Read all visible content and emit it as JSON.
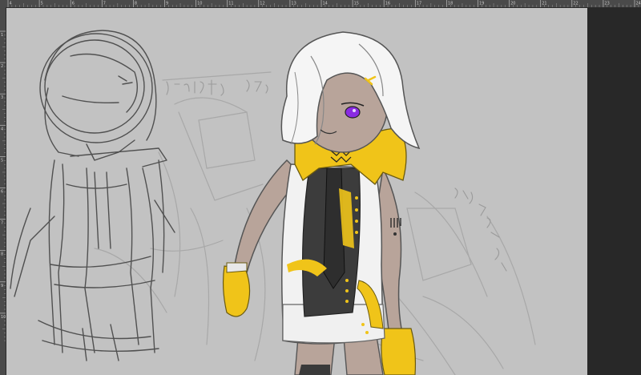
{
  "ruler": {
    "top_labels": [
      "4",
      "5",
      "6",
      "7",
      "8",
      "9",
      "10",
      "11",
      "12",
      "13",
      "14",
      "15",
      "16",
      "17",
      "18",
      "19",
      "20",
      "21",
      "22",
      "23",
      "24"
    ],
    "left_labels": [
      "1",
      "2",
      "3",
      "4",
      "5",
      "6",
      "7",
      "8",
      "9",
      "10"
    ]
  },
  "document": {
    "canvas_color": "#c2c2c2",
    "pasteboard_color": "#282828",
    "accent_yellow": "#f0c419",
    "eye_color": "#8a2be2"
  }
}
